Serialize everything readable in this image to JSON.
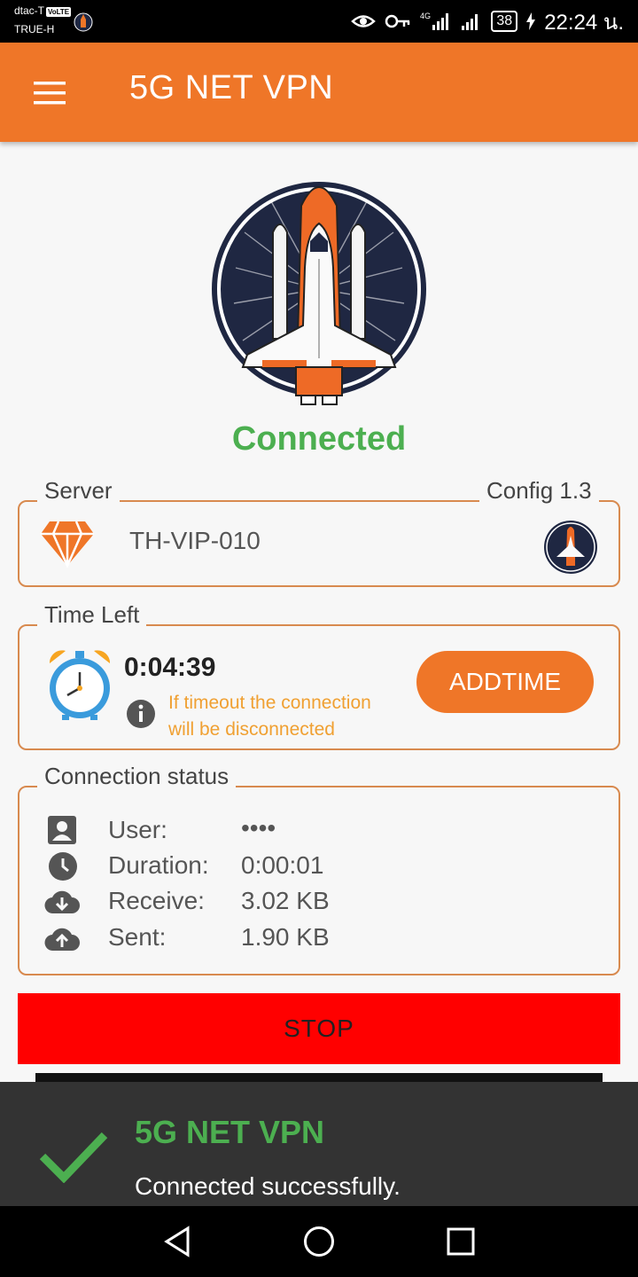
{
  "status_bar": {
    "carrier_1": "dtac-T",
    "carrier_2": "TRUE-H",
    "volte": "VoLTE",
    "network": "4G",
    "battery": "38",
    "time": "22:24 น."
  },
  "app_bar": {
    "title": "5G NET VPN",
    "menu_icon": "hamburger-menu-icon"
  },
  "hero": {
    "image": "space-shuttle-logo",
    "status_text": "Connected"
  },
  "server_box": {
    "legend": "Server",
    "config_label": "Config 1.3",
    "server_name": "TH-VIP-010",
    "server_icon": "diamond-icon"
  },
  "time_box": {
    "legend": "Time Left",
    "remaining": "0:04:39",
    "note_line_1": "If timeout the connection",
    "note_line_2": "will be disconnected",
    "addtime_label": "ADDTIME"
  },
  "connection_status": {
    "legend": "Connection status",
    "rows": [
      {
        "icon": "user-icon",
        "label": "User:",
        "value": "••••"
      },
      {
        "icon": "clock-icon",
        "label": "Duration:",
        "value": "0:00:01"
      },
      {
        "icon": "cloud-download-icon",
        "label": "Receive:",
        "value": "3.02 KB"
      },
      {
        "icon": "cloud-upload-icon",
        "label": "Sent:",
        "value": "1.90 KB"
      }
    ]
  },
  "stop_button": {
    "label": "STOP"
  },
  "toast": {
    "title": "5G NET VPN",
    "message": "Connected successfully."
  },
  "colors": {
    "accent": "#ef7628",
    "success": "#4caf50",
    "stop": "#ff0000",
    "navy": "#1f2742"
  }
}
